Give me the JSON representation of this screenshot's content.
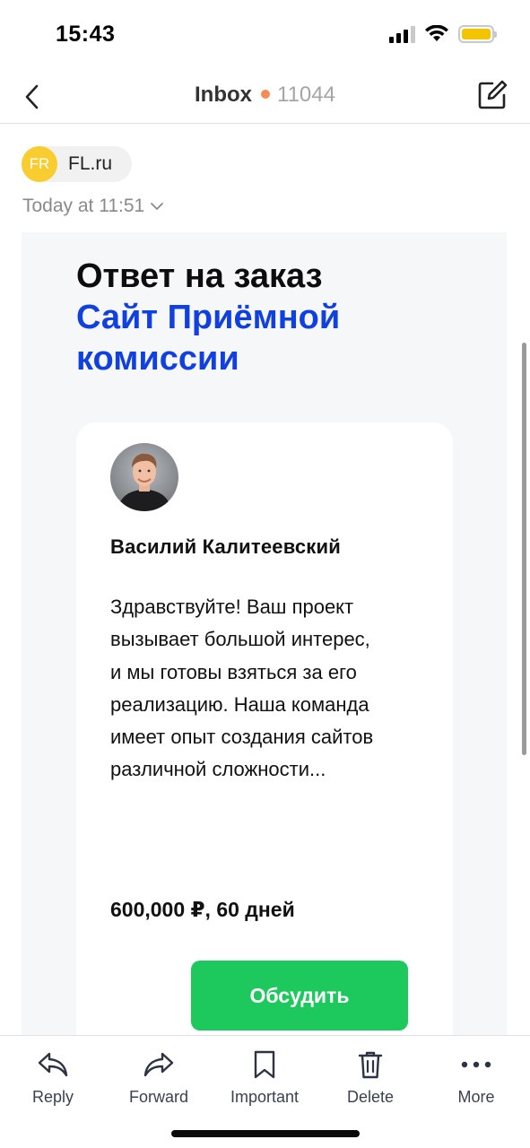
{
  "status_bar": {
    "time": "15:43",
    "battery_level": 1.0,
    "signal_bars": 3
  },
  "nav": {
    "title": "Inbox",
    "unread_count": "11044",
    "dot_color": "#f58a53"
  },
  "sender": {
    "initials": "FR",
    "name": "FL.ru",
    "avatar_color": "#f9cd2f"
  },
  "date": "Today at 11:51",
  "email": {
    "headline_black": "Ответ на заказ",
    "headline_blue": "Сайт Приёмной комиссии",
    "author_name": "Василий Калитеевский",
    "message": "Здравствуйте! Ваш проект вызывает большой интерес, и мы готовы взяться за его реализацию. Наша команда имеет опыт создания сайтов различной сложности...",
    "price": "600,000 ₽, 60 дней",
    "button_label": "Обсудить",
    "accent_blue": "#1140e0",
    "button_green": "#1dc95c"
  },
  "toolbar": {
    "reply": "Reply",
    "forward": "Forward",
    "important": "Important",
    "delete": "Delete",
    "more": "More"
  }
}
